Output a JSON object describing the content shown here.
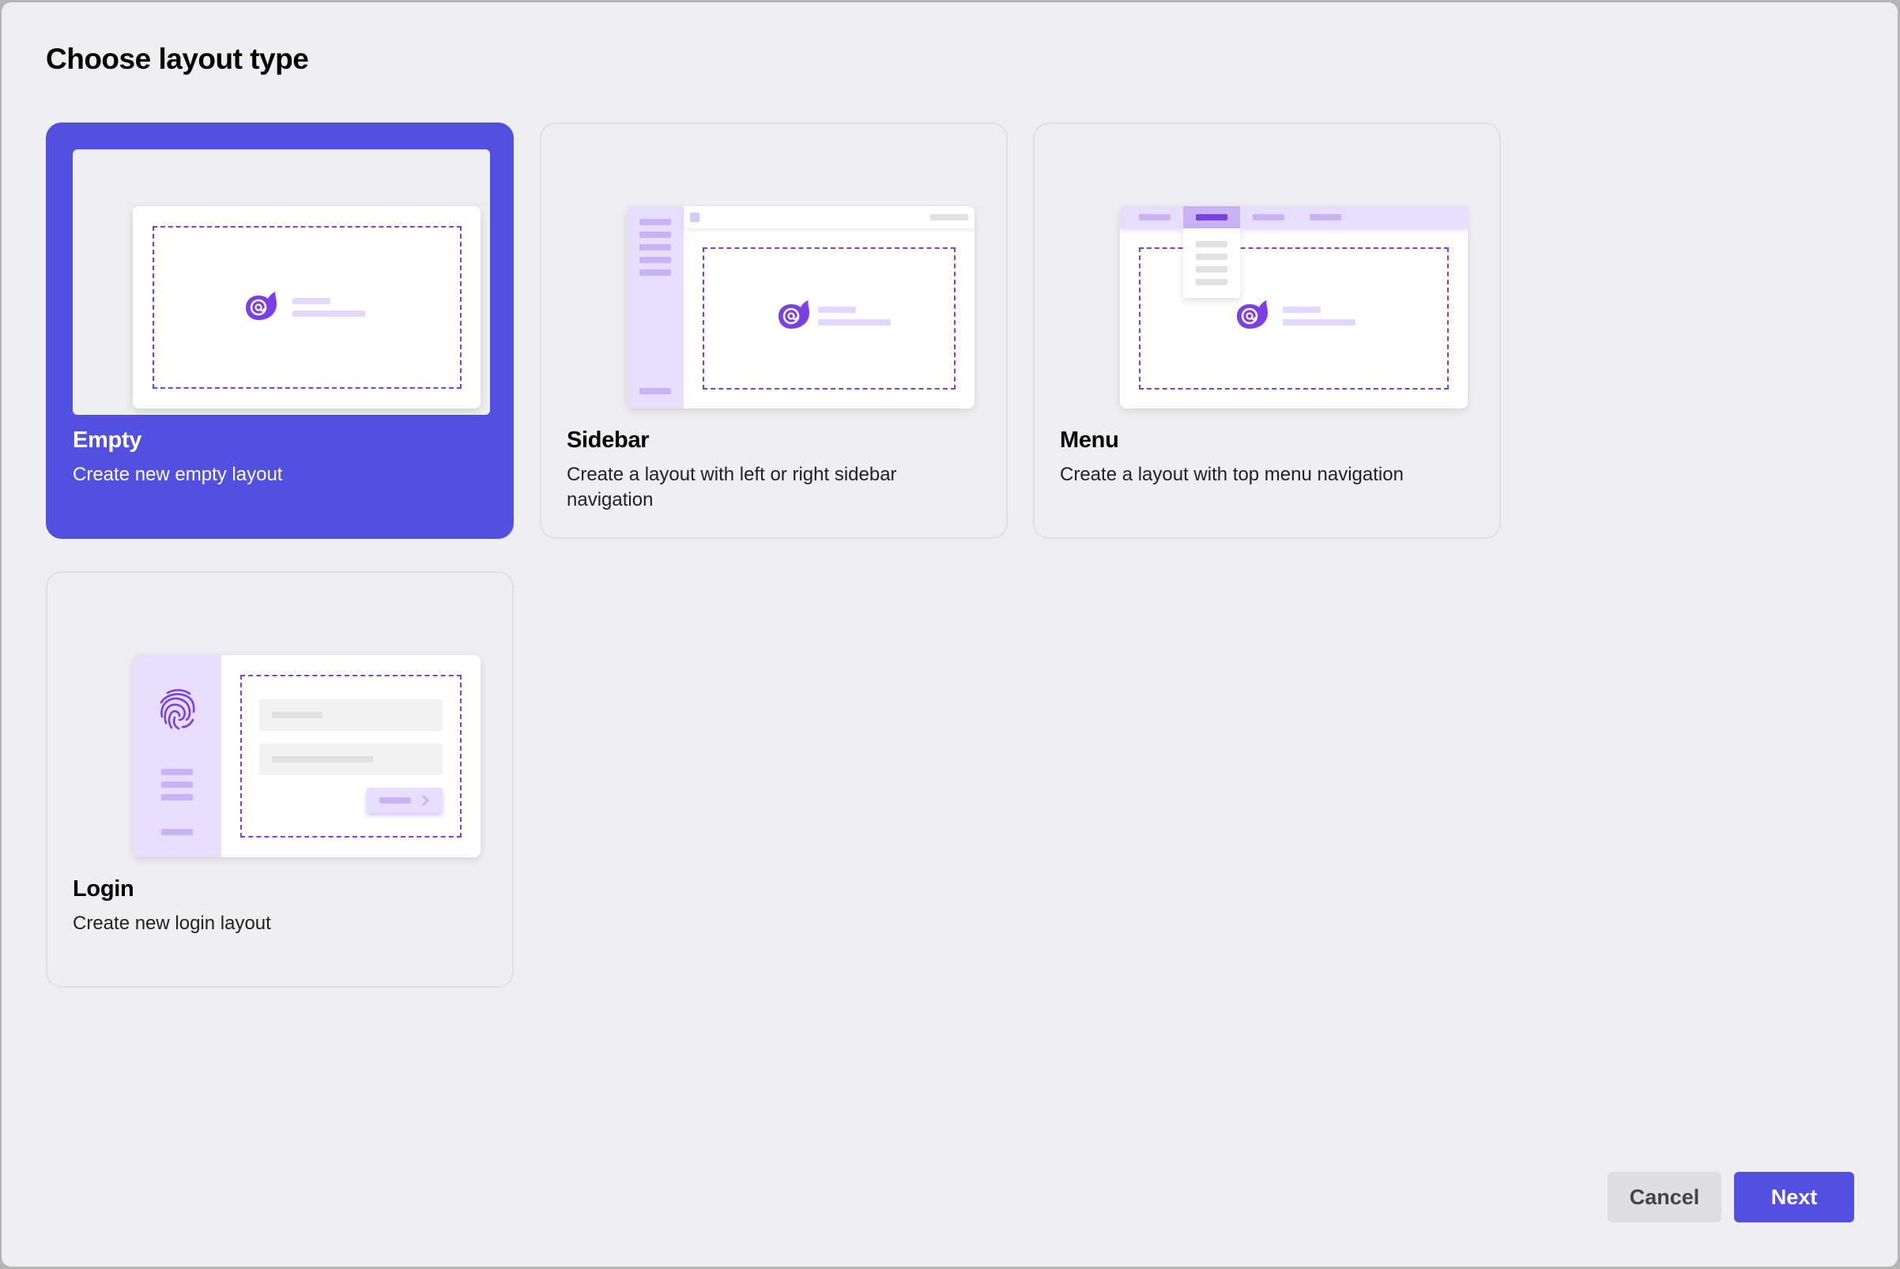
{
  "dialog": {
    "title": "Choose layout type"
  },
  "layouts": [
    {
      "id": "empty",
      "title": "Empty",
      "description": "Create new empty layout",
      "selected": true
    },
    {
      "id": "sidebar",
      "title": "Sidebar",
      "description": "Create a layout with left or right sidebar navigation",
      "selected": false
    },
    {
      "id": "menu",
      "title": "Menu",
      "description": "Create a layout with top menu navigation",
      "selected": false
    },
    {
      "id": "login",
      "title": "Login",
      "description": "Create new login layout",
      "selected": false
    }
  ],
  "footer": {
    "cancel_label": "Cancel",
    "next_label": "Next"
  },
  "colors": {
    "accent": "#5250e0",
    "illustration_purple": "#7b3fe8",
    "illustration_lavender": "#e3d8fb",
    "background": "#efeff1"
  },
  "icons": {
    "logo": "blazor-at-flame-icon",
    "login": "fingerprint-icon",
    "next_chevron": "chevron-right-icon"
  }
}
